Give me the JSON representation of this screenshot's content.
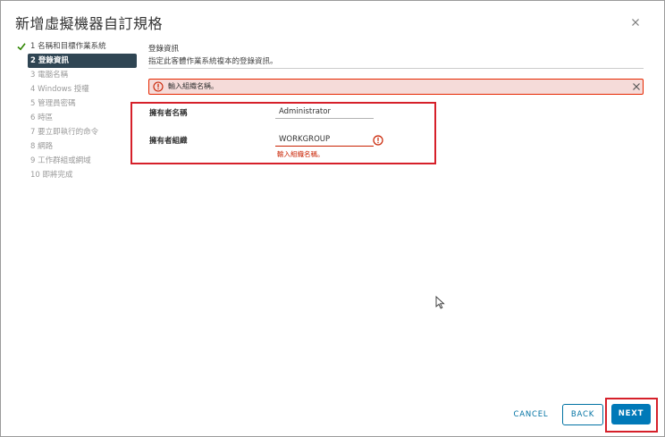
{
  "dialog": {
    "title": "新增虛擬機器自訂規格"
  },
  "steps": [
    {
      "label": "1 名稱和目標作業系統",
      "state": "done"
    },
    {
      "label": "2 登錄資訊",
      "state": "active"
    },
    {
      "label": "3 電腦名稱",
      "state": "pending"
    },
    {
      "label": "4 Windows 授權",
      "state": "pending"
    },
    {
      "label": "5 管理員密碼",
      "state": "pending"
    },
    {
      "label": "6 時區",
      "state": "pending"
    },
    {
      "label": "7 要立即執行的命令",
      "state": "pending"
    },
    {
      "label": "8 網路",
      "state": "pending"
    },
    {
      "label": "9 工作群組或網域",
      "state": "pending"
    },
    {
      "label": "10 即將完成",
      "state": "pending"
    }
  ],
  "section": {
    "title": "登錄資訊",
    "description": "指定此客體作業系統複本的登錄資訊。"
  },
  "alert": {
    "message": "輸入組織名稱。"
  },
  "form": {
    "owner_name_label": "擁有者名稱",
    "owner_name_value": "Administrator",
    "owner_org_label": "擁有者組織",
    "owner_org_value": "WORKGROUP",
    "owner_org_error": "輸入組織名稱。"
  },
  "footer": {
    "cancel_label": "CANCEL",
    "back_label": "BACK",
    "next_label": "NEXT"
  },
  "colors": {
    "primary": "#0079b8",
    "error": "#c92100",
    "highlight": "#d6202a",
    "active_step": "#2f4553",
    "done_check": "#2e8500"
  }
}
